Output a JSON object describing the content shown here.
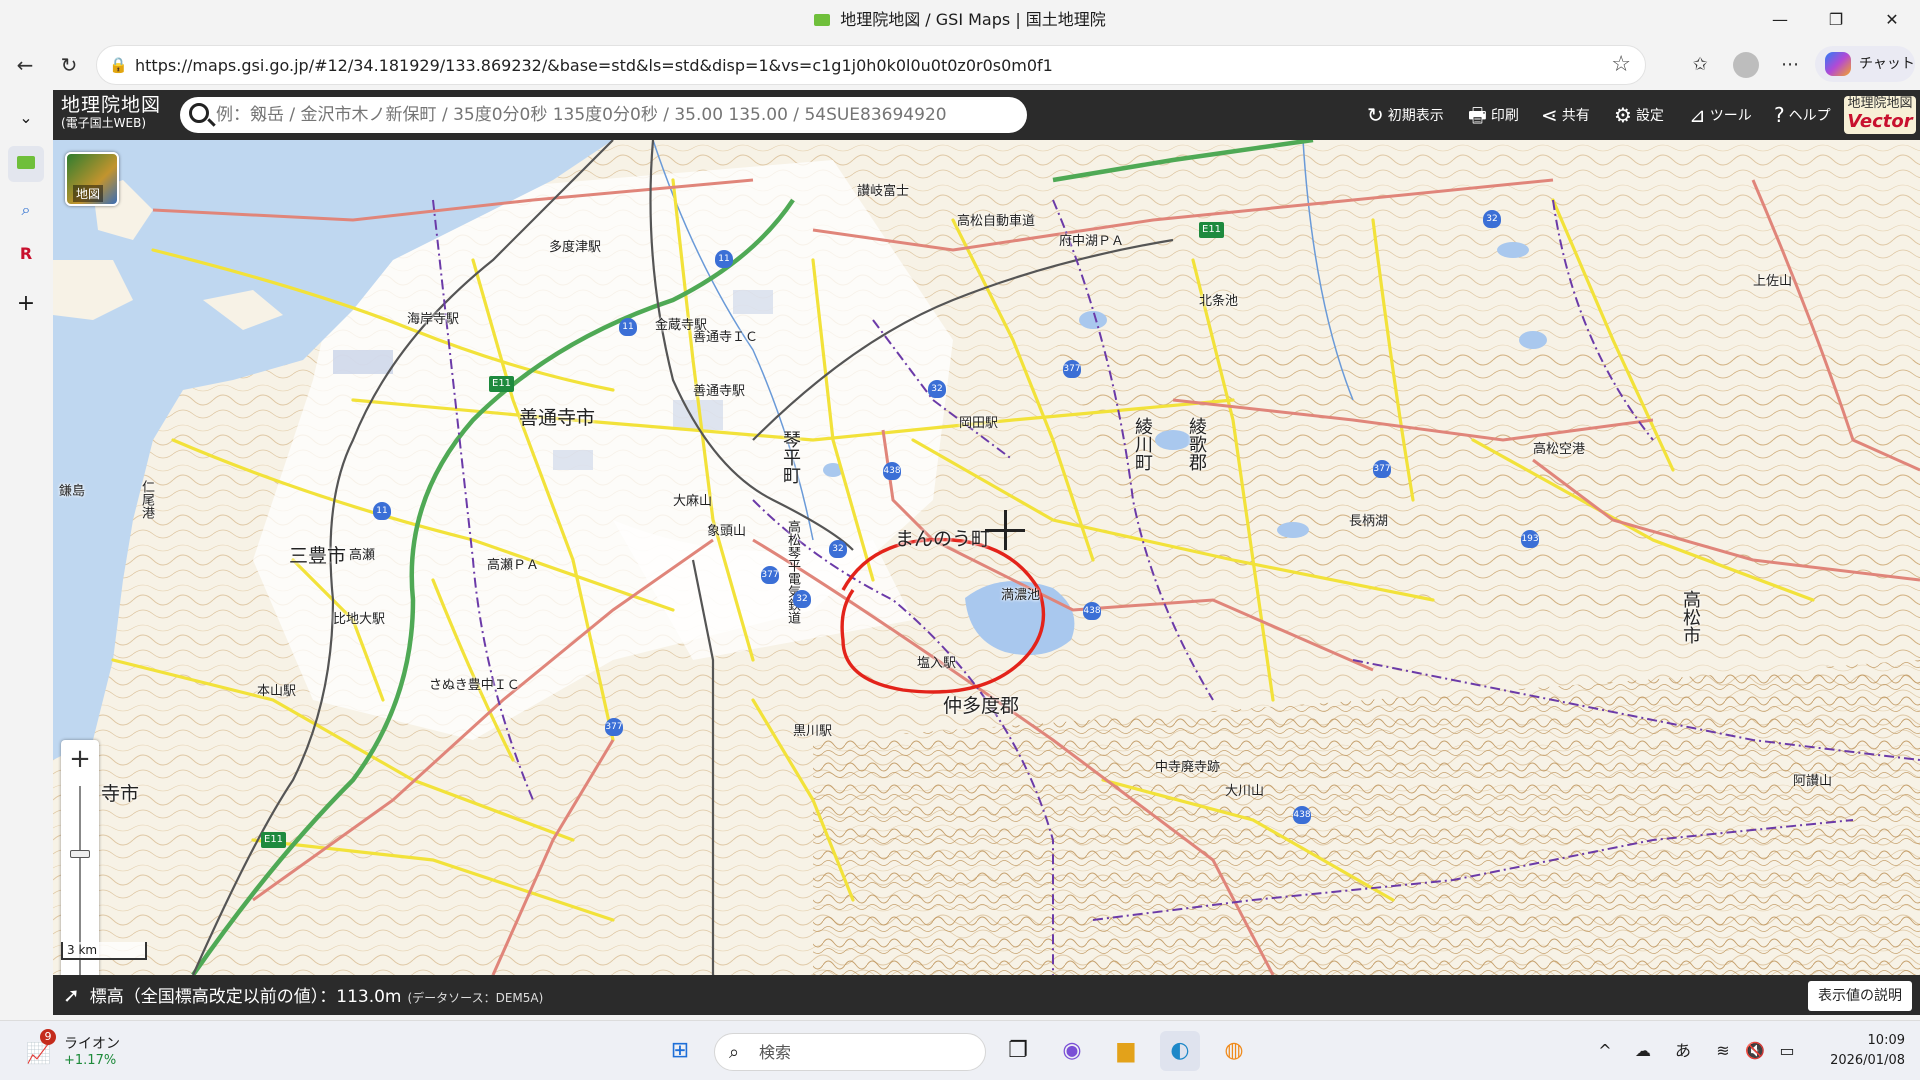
{
  "window": {
    "title": "地理院地図 / GSI Maps | 国土地理院"
  },
  "browser": {
    "url": "https://maps.gsi.go.jp/#12/34.181929/133.869232/&base=std&ls=std&disp=1&vs=c1g1j0h0k0l0u0t0z0r0s0m0f1",
    "copilot_label": "チャット"
  },
  "gsi": {
    "logo_main": "地理院地図",
    "logo_sub": "(電子国土WEB)",
    "search_placeholder": "例：剱岳 / 金沢市木ノ新保町 / 35度0分0秒 135度0分0秒 / 35.00 135.00 / 54SUE83694920",
    "toolbar": {
      "reset": "初期表示",
      "print": "印刷",
      "share": "共有",
      "settings": "設定",
      "tools": "ツール",
      "help": "ヘルプ"
    },
    "vector_badge_top": "地理院地図",
    "vector_badge": "Vector",
    "basemap_label": "地図",
    "scale_label": "3 km",
    "zoom_in": "+",
    "zoom_out": "−",
    "status_label": "標高（全国標高改定以前の値）：",
    "status_value": "113.0m",
    "status_source": "(データソース：DEM5A)",
    "explain_button": "表示値の説明"
  },
  "map_labels": {
    "cities": [
      {
        "id": "zentsuji",
        "text": "善通寺市"
      },
      {
        "id": "mitoyo",
        "text": "三豊市"
      },
      {
        "id": "manno",
        "text": "まんのう町"
      },
      {
        "id": "nakatado",
        "text": "仲多度郡"
      },
      {
        "id": "kanonji",
        "text": "寺市"
      }
    ],
    "vertical_cities": [
      {
        "id": "kotohira",
        "text": "琴平町"
      },
      {
        "id": "ayagawa",
        "text": "綾川町"
      },
      {
        "id": "ayauta",
        "text": "綾歌郡"
      },
      {
        "id": "takamatsu",
        "text": "高松市"
      }
    ],
    "features": [
      {
        "id": "mannoike",
        "text": "満濃池"
      },
      {
        "id": "shionyu",
        "text": "塩入駅"
      },
      {
        "id": "takamatsu_airport",
        "text": "高松空港"
      },
      {
        "id": "takamatsu_exp",
        "text": "高松自動車道"
      },
      {
        "id": "zentsuji_ic",
        "text": "善通寺ＩＣ"
      },
      {
        "id": "zentsuji_st",
        "text": "善通寺駅"
      },
      {
        "id": "konzoji",
        "text": "金蔵寺駅"
      },
      {
        "id": "kaigan",
        "text": "海岸寺駅"
      },
      {
        "id": "tadotsu",
        "text": "多度津駅"
      },
      {
        "id": "takamatsu_pa",
        "text": "高瀬ＰＡ"
      },
      {
        "id": "sanuki_toyonaka",
        "text": "さぬき豊中ＩＣ"
      },
      {
        "id": "hijidai",
        "text": "比地大駅"
      },
      {
        "id": "motoyama",
        "text": "本山駅"
      },
      {
        "id": "kurokawa",
        "text": "黒川駅"
      },
      {
        "id": "okada",
        "text": "岡田駅"
      },
      {
        "id": "nakatado_tera",
        "text": "中寺廃寺跡"
      },
      {
        "id": "ooasayama",
        "text": "大麻山"
      },
      {
        "id": "iyasan",
        "text": "象頭山"
      },
      {
        "id": "takase",
        "text": "高瀬"
      },
      {
        "id": "takamatsu_kinan",
        "text": "高松琴平電気鉄道"
      },
      {
        "id": "ootaki",
        "text": "大川山"
      },
      {
        "id": "sanuki_fuji",
        "text": "讃岐富士"
      },
      {
        "id": "fuchuko",
        "text": "府中湖ＰＡ"
      },
      {
        "id": "kitaike",
        "text": "北条池"
      },
      {
        "id": "nagatani",
        "text": "長柄湖"
      },
      {
        "id": "jogan",
        "text": "上佐山"
      },
      {
        "id": "kashima",
        "text": "鎌島"
      },
      {
        "id": "mitoyo_fukurou",
        "text": "仁尾港"
      },
      {
        "id": "awa",
        "text": "阿讃山"
      }
    ]
  }
}
